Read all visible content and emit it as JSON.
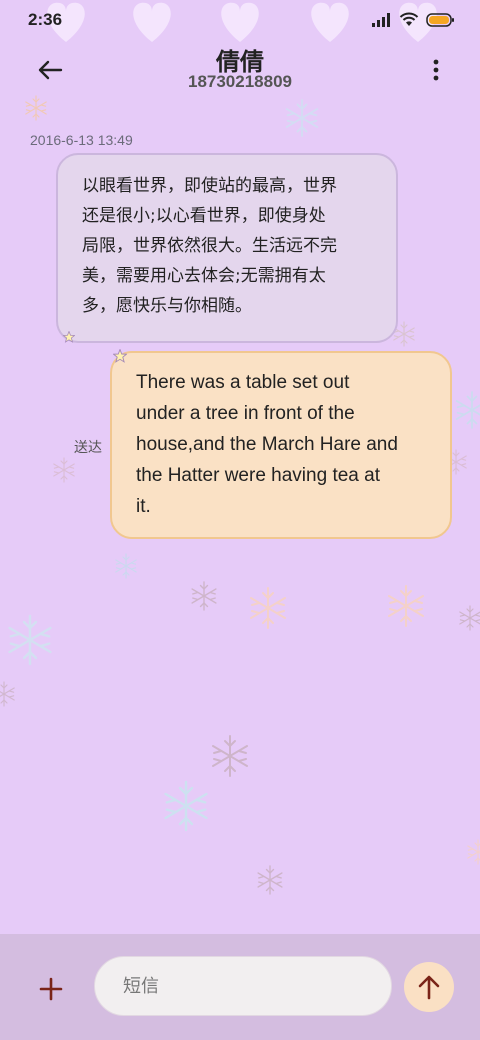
{
  "status_bar": {
    "time": "2:36",
    "icons": [
      "signal-icon",
      "wifi-icon",
      "battery-icon"
    ],
    "battery_color": "#f5a623"
  },
  "header": {
    "contact_name": "倩倩",
    "contact_number": "18730218809",
    "icons": [
      "back-arrow-icon",
      "more-vertical-icon"
    ]
  },
  "conversation": {
    "timestamp": "2016-6-13 13:49",
    "messages": [
      {
        "direction": "incoming",
        "lines": [
          "以眼看世界，即使站的最高，世界",
          "还是很小;以心看世界，即使身处",
          "局限，世界依然很大。生活远不完",
          "美，需要用心去体会;无需拥有太",
          "多，愿快乐与你相随。"
        ]
      },
      {
        "direction": "outgoing",
        "lines": [
          "There was a table set out",
          "under a tree in front of the",
          "house,and the March Hare and",
          "the Hatter were having tea at",
          "it."
        ],
        "status": "送达"
      }
    ]
  },
  "composer": {
    "placeholder": "短信",
    "icons": [
      "add-icon",
      "send-arrow-icon"
    ]
  },
  "colors": {
    "background": "#e6cbf8",
    "incoming_bubble": "#e4d6ed",
    "outgoing_bubble": "#fae1c5",
    "bottom_bar": "#d4bde0",
    "accent": "#7a2418"
  }
}
